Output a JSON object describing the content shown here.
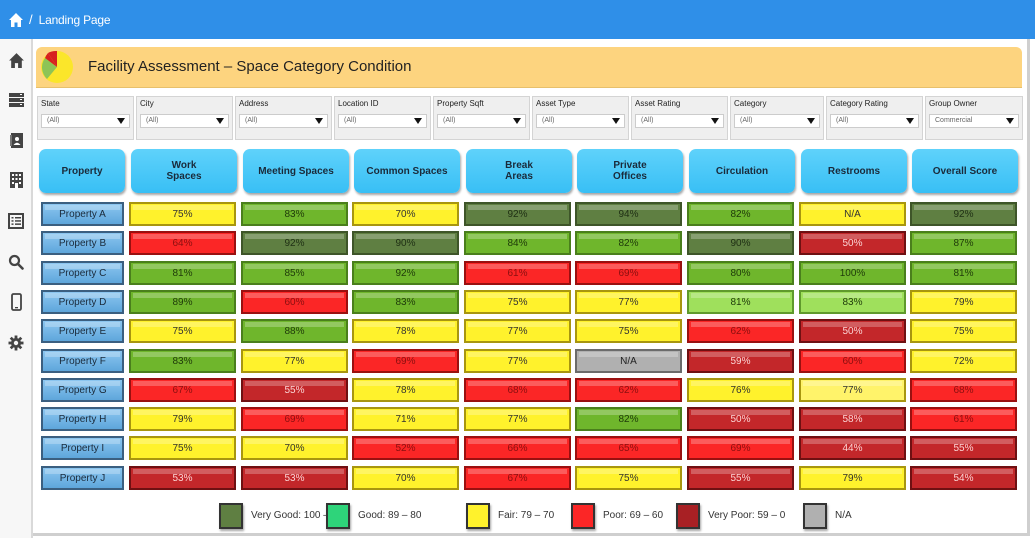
{
  "topbar": {
    "home_icon": "home-icon",
    "separator": "/",
    "breadcrumb": "Landing Page"
  },
  "sidebar": {
    "items": [
      {
        "icon": "home-icon",
        "label": "Home"
      },
      {
        "icon": "server-list-icon",
        "label": "Data"
      },
      {
        "icon": "contact-book-icon",
        "label": "Contacts"
      },
      {
        "icon": "building-icon",
        "label": "Buildings"
      },
      {
        "icon": "list-icon",
        "label": "Lists"
      },
      {
        "icon": "search-icon",
        "label": "Search"
      },
      {
        "icon": "mobile-icon",
        "label": "Mobile"
      },
      {
        "icon": "gear-icon",
        "label": "Settings"
      }
    ]
  },
  "banner": {
    "title": "Facility Assessment – Space Category Condition",
    "icon": "pie-chart-icon"
  },
  "filters": [
    {
      "label": "State",
      "value": "(All)"
    },
    {
      "label": "City",
      "value": "(All)"
    },
    {
      "label": "Address",
      "value": "(All)"
    },
    {
      "label": "Location ID",
      "value": "(All)"
    },
    {
      "label": "Property Sqft",
      "value": "(All)"
    },
    {
      "label": "Asset Type",
      "value": "(All)"
    },
    {
      "label": "Asset Rating",
      "value": "(All)"
    },
    {
      "label": "Category",
      "value": "(All)"
    },
    {
      "label": "Category Rating",
      "value": "(All)"
    },
    {
      "label": "Group Owner",
      "value": "Commercial"
    }
  ],
  "table": {
    "headers": [
      "Property",
      "Work Spaces",
      "Meeting Spaces",
      "Common Spaces",
      "Break Areas",
      "Private Offices",
      "Circulation",
      "Restrooms",
      "Overall Score"
    ],
    "rows": [
      {
        "property": "Property A",
        "cells": [
          {
            "v": "75%",
            "c": "f"
          },
          {
            "v": "83%",
            "c": "g"
          },
          {
            "v": "70%",
            "c": "f"
          },
          {
            "v": "92%",
            "c": "vg"
          },
          {
            "v": "94%",
            "c": "vg"
          },
          {
            "v": "82%",
            "c": "g"
          },
          {
            "v": "N/A",
            "c": "f"
          },
          {
            "v": "92%",
            "c": "vg"
          }
        ]
      },
      {
        "property": "Property B",
        "cells": [
          {
            "v": "64%",
            "c": "p"
          },
          {
            "v": "92%",
            "c": "vg"
          },
          {
            "v": "90%",
            "c": "vg"
          },
          {
            "v": "84%",
            "c": "g"
          },
          {
            "v": "82%",
            "c": "g"
          },
          {
            "v": "90%",
            "c": "vg"
          },
          {
            "v": "50%",
            "c": "vp"
          },
          {
            "v": "87%",
            "c": "g"
          }
        ]
      },
      {
        "property": "Property C",
        "cells": [
          {
            "v": "81%",
            "c": "g"
          },
          {
            "v": "85%",
            "c": "g"
          },
          {
            "v": "92%",
            "c": "g"
          },
          {
            "v": "61%",
            "c": "p"
          },
          {
            "v": "69%",
            "c": "p"
          },
          {
            "v": "80%",
            "c": "g"
          },
          {
            "v": "100%",
            "c": "g"
          },
          {
            "v": "81%",
            "c": "g"
          }
        ]
      },
      {
        "property": "Property D",
        "cells": [
          {
            "v": "89%",
            "c": "g"
          },
          {
            "v": "60%",
            "c": "p"
          },
          {
            "v": "83%",
            "c": "g"
          },
          {
            "v": "75%",
            "c": "f"
          },
          {
            "v": "77%",
            "c": "f"
          },
          {
            "v": "81%",
            "c": "gl"
          },
          {
            "v": "83%",
            "c": "gl"
          },
          {
            "v": "79%",
            "c": "f"
          }
        ]
      },
      {
        "property": "Property E",
        "cells": [
          {
            "v": "75%",
            "c": "f"
          },
          {
            "v": "88%",
            "c": "g"
          },
          {
            "v": "78%",
            "c": "f"
          },
          {
            "v": "77%",
            "c": "f"
          },
          {
            "v": "75%",
            "c": "f"
          },
          {
            "v": "62%",
            "c": "p"
          },
          {
            "v": "50%",
            "c": "vp"
          },
          {
            "v": "75%",
            "c": "f"
          }
        ]
      },
      {
        "property": "Property F",
        "cells": [
          {
            "v": "83%",
            "c": "g"
          },
          {
            "v": "77%",
            "c": "f"
          },
          {
            "v": "69%",
            "c": "p"
          },
          {
            "v": "77%",
            "c": "f"
          },
          {
            "v": "N/A",
            "c": "na"
          },
          {
            "v": "59%",
            "c": "vp"
          },
          {
            "v": "60%",
            "c": "p"
          },
          {
            "v": "72%",
            "c": "f"
          }
        ]
      },
      {
        "property": "Property G",
        "cells": [
          {
            "v": "67%",
            "c": "p"
          },
          {
            "v": "55%",
            "c": "vp"
          },
          {
            "v": "78%",
            "c": "f"
          },
          {
            "v": "68%",
            "c": "p"
          },
          {
            "v": "62%",
            "c": "p"
          },
          {
            "v": "76%",
            "c": "f"
          },
          {
            "v": "77%",
            "c": "fl"
          },
          {
            "v": "68%",
            "c": "p"
          }
        ]
      },
      {
        "property": "Property H",
        "cells": [
          {
            "v": "79%",
            "c": "f"
          },
          {
            "v": "69%",
            "c": "p"
          },
          {
            "v": "71%",
            "c": "f"
          },
          {
            "v": "77%",
            "c": "f"
          },
          {
            "v": "82%",
            "c": "g"
          },
          {
            "v": "50%",
            "c": "vp"
          },
          {
            "v": "58%",
            "c": "vp"
          },
          {
            "v": "61%",
            "c": "p"
          }
        ]
      },
      {
        "property": "Property I",
        "cells": [
          {
            "v": "75%",
            "c": "f"
          },
          {
            "v": "70%",
            "c": "f"
          },
          {
            "v": "52%",
            "c": "p"
          },
          {
            "v": "66%",
            "c": "p"
          },
          {
            "v": "65%",
            "c": "p"
          },
          {
            "v": "69%",
            "c": "p"
          },
          {
            "v": "44%",
            "c": "vp"
          },
          {
            "v": "55%",
            "c": "vp"
          }
        ]
      },
      {
        "property": "Property J",
        "cells": [
          {
            "v": "53%",
            "c": "vp"
          },
          {
            "v": "53%",
            "c": "vp"
          },
          {
            "v": "70%",
            "c": "f"
          },
          {
            "v": "67%",
            "c": "p"
          },
          {
            "v": "75%",
            "c": "f"
          },
          {
            "v": "55%",
            "c": "vp"
          },
          {
            "v": "79%",
            "c": "f"
          },
          {
            "v": "54%",
            "c": "vp"
          }
        ]
      }
    ]
  },
  "legend": [
    {
      "label": "Very Good:  100 – 90",
      "color": "#5f7f42"
    },
    {
      "label": "Good:  89 – 80",
      "color": "#2ed47a"
    },
    {
      "label": "Fair: 79 – 70",
      "color": "#fff22c"
    },
    {
      "label": "Poor:  69 – 60",
      "color": "#fb2626"
    },
    {
      "label": "Very Poor: 59 – 0",
      "color": "#a82024"
    },
    {
      "label": "N/A",
      "color": "#b0b0b0"
    }
  ]
}
